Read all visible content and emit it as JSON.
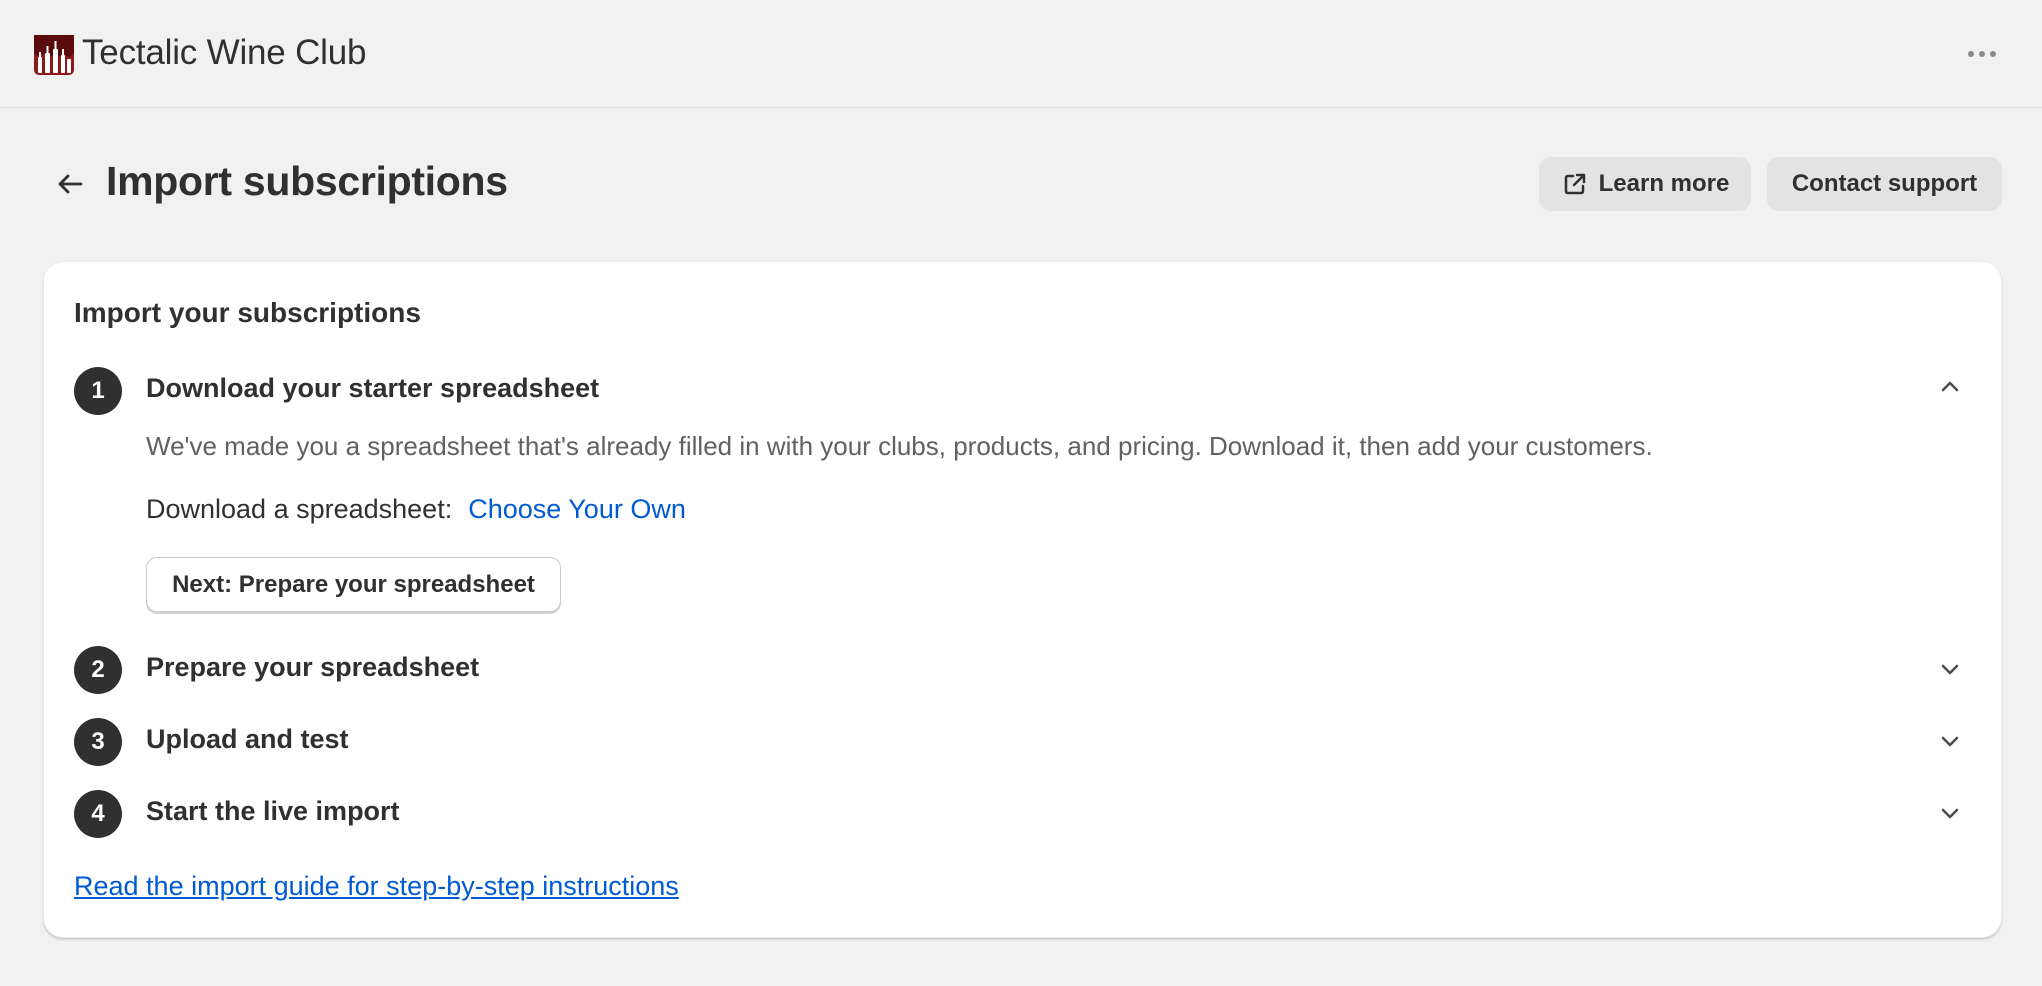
{
  "app": {
    "name": "Tectalic Wine Club",
    "logo_icon": "wine-bottles-logo",
    "menu_icon": "more-horizontal-icon"
  },
  "header": {
    "back_icon": "arrow-left-icon",
    "title": "Import subscriptions",
    "learn_more_label": "Learn more",
    "learn_more_icon": "external-link-icon",
    "contact_support_label": "Contact support"
  },
  "card": {
    "title": "Import your subscriptions",
    "steps": [
      {
        "number": "1",
        "label": "Download your starter spreadsheet",
        "expanded": true,
        "description": "We've made you a spreadsheet that's already filled in with your clubs, products, and pricing. Download it, then add your customers.",
        "download_prefix": "Download a spreadsheet:",
        "download_link": "Choose Your Own",
        "next_button": "Next: Prepare your spreadsheet"
      },
      {
        "number": "2",
        "label": "Prepare your spreadsheet",
        "expanded": false
      },
      {
        "number": "3",
        "label": "Upload and test",
        "expanded": false
      },
      {
        "number": "4",
        "label": "Start the live import",
        "expanded": false
      }
    ],
    "guide_link": "Read the import guide for step-by-step instructions"
  },
  "colors": {
    "background": "#f1f1f1",
    "card": "#ffffff",
    "text_primary": "#303030",
    "text_secondary": "#616161",
    "link": "#005bd3",
    "logo_red": "#8b1a1a",
    "button_secondary": "#e3e3e3"
  }
}
